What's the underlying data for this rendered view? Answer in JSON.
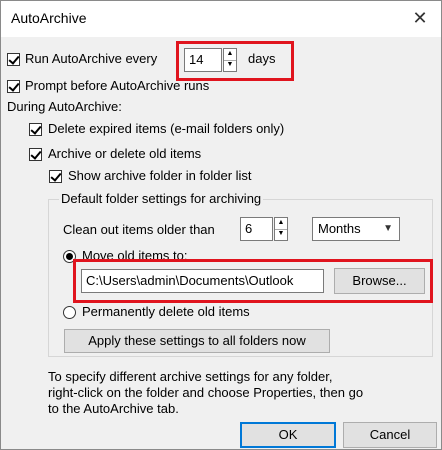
{
  "window": {
    "title": "AutoArchive",
    "close_glyph": "✕"
  },
  "run_every": {
    "label": "Run AutoArchive every",
    "value": "14",
    "unit": "days",
    "checked": true
  },
  "prompt": {
    "label": "Prompt before AutoArchive runs",
    "checked": true
  },
  "during": {
    "label": "During AutoArchive:"
  },
  "delete_expired": {
    "label": "Delete expired items (e-mail folders only)",
    "checked": true
  },
  "archive_old": {
    "label": "Archive or delete old items",
    "checked": true
  },
  "show_folder": {
    "label": "Show archive folder in folder list",
    "checked": true
  },
  "defaults": {
    "legend": "Default folder settings for archiving",
    "clean_label": "Clean out items older than",
    "clean_value": "6",
    "period": "Months",
    "move_label": "Move old items to:",
    "path": "C:\\Users\\admin\\Documents\\Outlook",
    "browse": "Browse...",
    "perm_delete": "Permanently delete old items",
    "apply": "Apply these settings to all folders now"
  },
  "note": {
    "line1": "To specify different archive settings for any folder,",
    "line2": "right-click on the folder and choose Properties, then go",
    "line3": "to the AutoArchive tab."
  },
  "buttons": {
    "ok": "OK",
    "cancel": "Cancel"
  },
  "colors": {
    "highlight": "#e0141e",
    "focus": "#0078d7"
  }
}
